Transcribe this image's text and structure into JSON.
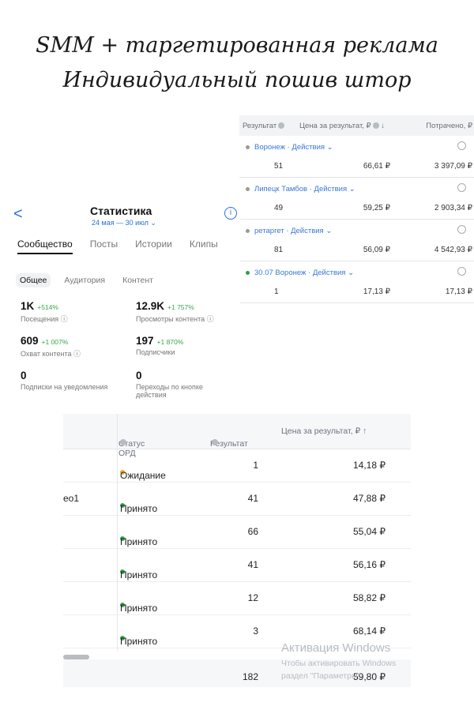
{
  "title_line1": "SMM + таргетированная реклама",
  "title_line2": "Индивидуальный пошив штор",
  "ads": {
    "headers": {
      "result": "Результат",
      "price": "Цена за результат, ₽",
      "spent": "Потрачено, ₽"
    },
    "rows": [
      {
        "name": "Воронеж · Действия ⌄",
        "result": "51",
        "price": "66,61 ₽",
        "spent": "3 397,09 ₽",
        "dot_color": "#999999"
      },
      {
        "name": "Липецк Тамбов · Действия ⌄",
        "result": "49",
        "price": "59,25 ₽",
        "spent": "2 903,34 ₽",
        "dot_color": "#999999"
      },
      {
        "name": "ретаргет · Действия ⌄",
        "result": "81",
        "price": "56,09 ₽",
        "spent": "4 542,93 ₽",
        "dot_color": "#999999"
      },
      {
        "name": "30.07 Воронеж · Действия ⌄",
        "result": "1",
        "price": "17,13 ₽",
        "spent": "17,13 ₽",
        "dot_color": "#2e9e4a"
      }
    ]
  },
  "vk": {
    "back": "<",
    "header": "Статистика",
    "date": "24 мая — 30 июл ⌄",
    "info": "i",
    "tabs": [
      "Сообщество",
      "Посты",
      "Истории",
      "Клипы"
    ],
    "subtabs": [
      "Общее",
      "Аудитория",
      "Контент"
    ],
    "stats": [
      {
        "value": "1K",
        "delta": "+514%",
        "label": "Посещения ⓘ"
      },
      {
        "value": "12.9K",
        "delta": "+1 757%",
        "label": "Просмотры контента ⓘ"
      },
      {
        "value": "609",
        "delta": "+1 007%",
        "label": "Охват контента ⓘ"
      },
      {
        "value": "197",
        "delta": "+1 870%",
        "label": "Подписчики"
      },
      {
        "value": "0",
        "delta": "",
        "label": "Подписки на уведомления"
      },
      {
        "value": "0",
        "delta": "",
        "label": "Переходы по кнопке действия"
      }
    ]
  },
  "table": {
    "headers": {
      "status": "Статус ОРД",
      "result": "Результат",
      "price": "Цена за результат, ₽ ↑"
    },
    "rows": [
      {
        "left": "",
        "status": "Ожидание",
        "result": "1",
        "price": "14,18 ₽",
        "status_color": "#f5a623"
      },
      {
        "left": "eo1",
        "status": "Принято",
        "result": "41",
        "price": "47,88 ₽",
        "status_color": "#34a853"
      },
      {
        "left": "",
        "status": "Принято",
        "result": "66",
        "price": "55,04 ₽",
        "status_color": "#34a853"
      },
      {
        "left": "",
        "status": "Принято",
        "result": "41",
        "price": "56,16 ₽",
        "status_color": "#34a853"
      },
      {
        "left": "",
        "status": "Принято",
        "result": "12",
        "price": "58,82 ₽",
        "status_color": "#34a853"
      },
      {
        "left": "",
        "status": "Принято",
        "result": "3",
        "price": "68,14 ₽",
        "status_color": "#34a853"
      }
    ],
    "footer": {
      "result": "182",
      "price": "59,80 ₽"
    }
  },
  "watermark": {
    "title": "Активация Windows",
    "line1": "Чтобы активировать Windows",
    "line2": "раздел \"Параметры\"."
  }
}
